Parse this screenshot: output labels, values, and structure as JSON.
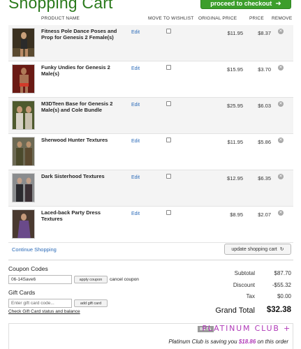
{
  "header": {
    "title": "Shopping Cart",
    "checkout_label": "proceed to checkout",
    "checkout_icon": "arrow-right-icon",
    "accent": "#3c9e2b"
  },
  "table": {
    "columns": [
      "PRODUCT NAME",
      "MOVE TO WISHLIST",
      "ORIGINAL PRICE",
      "PRICE",
      "REMOVE"
    ],
    "edit_label": "Edit",
    "rows": [
      {
        "name": "Fitness Pole Dance Poses and Prop for Genesis 2 Female(s)",
        "original_price": "$11.95",
        "price": "$8.37",
        "wishlist_checked": false
      },
      {
        "name": "Funky Undies for Genesis 2 Male(s)",
        "original_price": "$15.95",
        "price": "$3.70",
        "wishlist_checked": false
      },
      {
        "name": "M3DTeen Base for Genesis 2 Male(s) and Cole Bundle",
        "original_price": "$25.95",
        "price": "$6.03",
        "wishlist_checked": false
      },
      {
        "name": "Sherwood Hunter Textures",
        "original_price": "$11.95",
        "price": "$5.86",
        "wishlist_checked": false
      },
      {
        "name": "Dark Sisterhood Textures",
        "original_price": "$12.95",
        "price": "$6.35",
        "wishlist_checked": false
      },
      {
        "name": "Laced-back Party Dress Textures",
        "original_price": "$8.95",
        "price": "$2.07",
        "wishlist_checked": false
      }
    ]
  },
  "actions": {
    "continue_label": "Continue Shopping",
    "update_label": "update shopping cart",
    "update_icon": "refresh-icon"
  },
  "coupon": {
    "title": "Coupon Codes",
    "value": "06-14Save6",
    "apply_label": "apply coupon",
    "cancel_label": "cancel coupon"
  },
  "gift": {
    "title": "Gift Cards",
    "placeholder": "Enter gift card code...",
    "add_label": "add gift card",
    "status_link": "Check Gift Card status and balance"
  },
  "totals": {
    "subtotal_label": "Subtotal",
    "subtotal": "$87.70",
    "discount_label": "Discount",
    "discount": "-$55.32",
    "tax_label": "Tax",
    "tax": "$0.00",
    "grand_label": "Grand Total",
    "grand": "$32.38"
  },
  "platinum": {
    "beta": "BETA",
    "logo": "PLATINUM CLUB +",
    "saving_prefix": "Platinum Club is saving you",
    "saving_amount": "$18.86",
    "saving_suffix": "on this order",
    "color": "#b03ab8"
  }
}
